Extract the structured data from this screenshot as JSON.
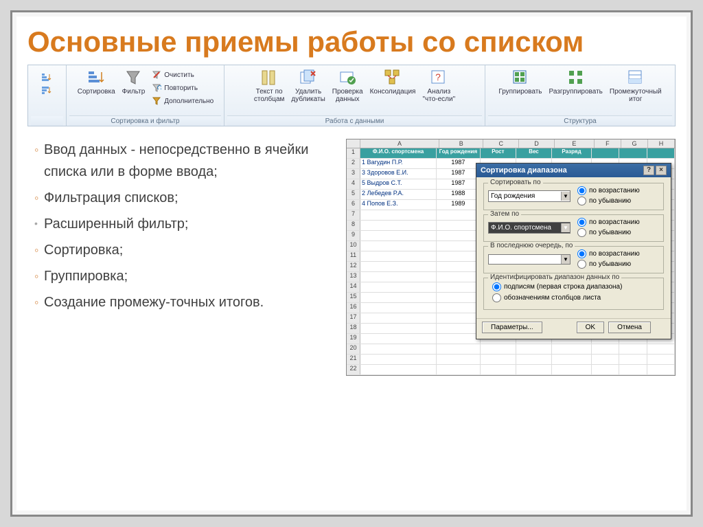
{
  "slide": {
    "title": "Основные приемы работы со списком"
  },
  "ribbon": {
    "group1": {
      "label": "Сортировка и фильтр",
      "sort": "Сортировка",
      "filter": "Фильтр",
      "clear": "Очистить",
      "reapply": "Повторить",
      "advanced": "Дополнительно"
    },
    "group2": {
      "label": "Работа с данными",
      "textToCols": "Текст по\nстолбцам",
      "removeDup": "Удалить\nдубликаты",
      "validation": "Проверка\nданных",
      "consolidate": "Консолидация",
      "whatIf": "Анализ\n\"что-если\""
    },
    "group3": {
      "label": "Структура",
      "group": "Группировать",
      "ungroup": "Разгруппировать",
      "subtotal": "Промежуточный\nитог"
    }
  },
  "bullets": {
    "b1": "Ввод данных - непосредственно в ячейки списка или в форме ввода;",
    "b2": "Фильтрация списков;",
    "b3": "Расширенный фильтр;",
    "b4": "Сортировка;",
    "b5": "Группировка;",
    "b6": "Создание промежу-точных итогов."
  },
  "sheet": {
    "cols": [
      "A",
      "B",
      "C",
      "D",
      "E",
      "F",
      "G",
      "H"
    ],
    "hdr": {
      "c0": "Ф.И.О. спортсмена",
      "c1": "Год\nрождения",
      "c2": "Рост",
      "c3": "Вес",
      "c4": "Разряд"
    },
    "rows": [
      {
        "n": "1 Вагудин П.Р.",
        "y": "1987"
      },
      {
        "n": "3 Здоровов Е.И.",
        "y": "1987"
      },
      {
        "n": "5 Выдров С.Т.",
        "y": "1987"
      },
      {
        "n": "2 Лебедев Р.А.",
        "y": "1988"
      },
      {
        "n": "4 Попов Е.З.",
        "y": "1989"
      }
    ]
  },
  "dialog": {
    "title": "Сортировка диапазона",
    "sortBy": "Сортировать по",
    "thenBy": "Затем по",
    "lastBy": "В последнюю очередь, по",
    "combo1": "Год рождения",
    "combo2": "Ф.И.О. спортсмена",
    "combo3": "",
    "asc": "по возрастанию",
    "desc": "по убыванию",
    "identTitle": "Идентифицировать диапазон данных по",
    "identOpt1": "подписям (первая строка диапазона)",
    "identOpt2": "обозначениям столбцов листа",
    "btnParams": "Параметры...",
    "btnOk": "OK",
    "btnCancel": "Отмена"
  }
}
